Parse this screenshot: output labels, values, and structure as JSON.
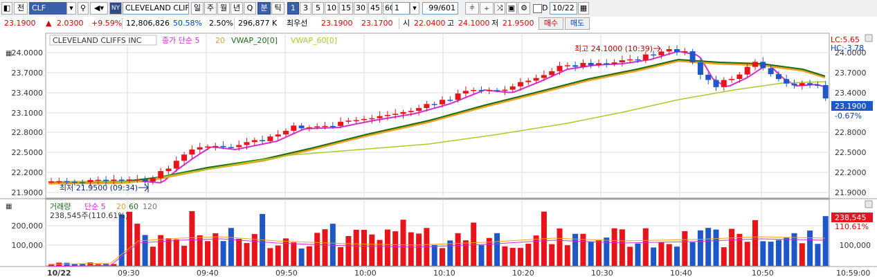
{
  "toolbar": {
    "mode_label": "전",
    "symbol": "CLF",
    "exchange_badge": "NY",
    "company_name": "CLEVELAND CLIFFS",
    "period_day": "일",
    "period_week": "주",
    "period_month": "월",
    "period_year": "년",
    "period_q": "Q",
    "period_min": "분",
    "period_tick": "틱",
    "intervals": [
      "1",
      "3",
      "5",
      "10",
      "15",
      "30",
      "45",
      "60"
    ],
    "interval_value": "1",
    "count_display": "99/601",
    "date_value": "10/22",
    "checkbox_label": "D"
  },
  "quote": {
    "price": "23.1900",
    "change": "2.0300",
    "change_pct": "+9.59%",
    "volume": "12,806,826",
    "volume_ratio": "50.58%",
    "turnover": "2.50%",
    "amount": "296,877 K",
    "best_label": "최우선",
    "best_ask": "23.1900",
    "best_bid": "23.1700",
    "open_label": "시",
    "open": "22.0400",
    "high_label": "고",
    "high": "24.1000",
    "low_label": "저",
    "low": "21.9500",
    "buy_label": "매수",
    "sell_label": "매도"
  },
  "price_panel": {
    "title": "CLEVELAND CLIFFS INC",
    "legend_ma": "종가 단순 5",
    "legend_ma20": "20",
    "legend_vwap20": "VWAP_20[0]",
    "legend_vwap60": "VWAP_60[0]",
    "hi_annotation": "최고 24.1000 (10:39)",
    "lo_annotation": "최저 21.9500 (09:34)",
    "lc_label": "LC:5.65",
    "hc_label": "HC:-3.78",
    "current_price": "23.1900",
    "current_change": "-0.67%",
    "colors": {
      "up": "#e8141c",
      "down": "#1e58c8",
      "ma5": "#d62ad4",
      "ma20": "#f0a020",
      "vwap20": "#1a6e1a",
      "vwap60": "#a8cc28"
    }
  },
  "volume_panel": {
    "legend_title": "거래량",
    "legend_ma": "단순 5",
    "legend_20": "20",
    "legend_60": "60",
    "legend_120": "120",
    "value_label": "238,545주(110.61%)",
    "current_volume": "238,545",
    "current_ratio": "110.61%"
  },
  "x_axis": {
    "date_label": "10/22",
    "ticks": [
      "09:30",
      "09:40",
      "09:50",
      "10:00",
      "10:10",
      "10:20",
      "10:30",
      "10:40",
      "10:50"
    ],
    "last_time": "10:59:00"
  },
  "chart_data": {
    "type": "candlestick",
    "title": "CLEVELAND CLIFFS INC",
    "y_ticks": [
      "24.0000",
      "23.7000",
      "23.4000",
      "23.1000",
      "22.8000",
      "22.5000",
      "22.2000",
      "21.9000"
    ],
    "y_range": [
      21.85,
      24.15
    ],
    "volume_ticks": [
      "200,000",
      "100,000"
    ],
    "volume_range": [
      0,
      310000
    ],
    "grid": true
  }
}
